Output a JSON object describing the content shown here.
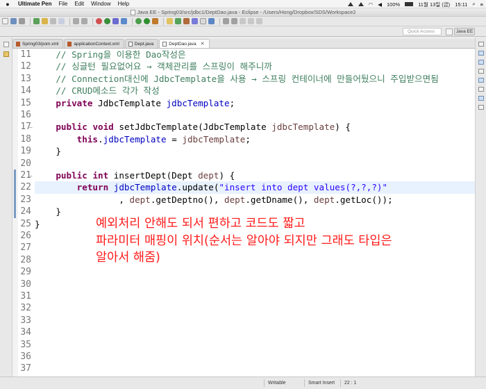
{
  "menubar": {
    "app_name": "Ultimate Pen",
    "menus": [
      "File",
      "Edit",
      "Window",
      "Help"
    ],
    "battery": "100%",
    "date": "11월 13일 (금)",
    "time": "15:11"
  },
  "window": {
    "title": "Java EE - Spring03/src/jdbc1/DeptDao.java - Eclipse - /Users/Hong/Dropbox/SDS/Workspace2"
  },
  "toolbar": {
    "quick_access_placeholder": "Quick Access",
    "perspective_label": "Java EE"
  },
  "tabs": [
    {
      "label": "Spring03/pom.xml",
      "icon": "xml-file-icon",
      "active": false
    },
    {
      "label": "applicationContext.xml",
      "icon": "xml-file-icon",
      "active": false
    },
    {
      "label": "Dept.java",
      "icon": "java-file-icon",
      "active": false
    },
    {
      "label": "DeptDao.java",
      "icon": "java-file-icon",
      "active": true,
      "close": "✕"
    }
  ],
  "editor": {
    "line_numbers": [
      "11",
      "12",
      "13",
      "14",
      "15",
      "16",
      "17",
      "18",
      "19",
      "20",
      "21",
      "22",
      "23",
      "24",
      "25",
      "26",
      "27",
      "28",
      "29",
      "30",
      "31",
      "32",
      "33",
      "34",
      "35",
      "36",
      "37"
    ],
    "lines": [
      [
        {
          "t": "    ",
          "c": ""
        },
        {
          "t": "// Spring을 이용한 Dao작성은",
          "c": "cm"
        }
      ],
      [
        {
          "t": "    ",
          "c": ""
        },
        {
          "t": "// 싱글턴 필요없어요 → 객체관리를 스프링이 해주니까",
          "c": "cm"
        }
      ],
      [
        {
          "t": "    ",
          "c": ""
        },
        {
          "t": "// Connection대신에 JdbcTemplate을 사용 → 스프링 컨테이너에 만들어뒀으니 주입받으면됨",
          "c": "cm"
        }
      ],
      [
        {
          "t": "    ",
          "c": ""
        },
        {
          "t": "// CRUD메소드 각가 작성",
          "c": "cm"
        }
      ],
      [
        {
          "t": "    ",
          "c": ""
        },
        {
          "t": "private",
          "c": "kw"
        },
        {
          "t": " JdbcTemplate ",
          "c": ""
        },
        {
          "t": "jdbcTemplate",
          "c": "fd"
        },
        {
          "t": ";",
          "c": ""
        }
      ],
      [],
      [
        {
          "t": "    ",
          "c": ""
        },
        {
          "t": "public",
          "c": "kw"
        },
        {
          "t": " ",
          "c": ""
        },
        {
          "t": "void",
          "c": "kw"
        },
        {
          "t": " setJdbcTemplate(JdbcTemplate ",
          "c": ""
        },
        {
          "t": "jdbcTemplate",
          "c": "pr"
        },
        {
          "t": ") {",
          "c": ""
        }
      ],
      [
        {
          "t": "        ",
          "c": ""
        },
        {
          "t": "this",
          "c": "kw"
        },
        {
          "t": ".",
          "c": ""
        },
        {
          "t": "jdbcTemplate",
          "c": "fd"
        },
        {
          "t": " = ",
          "c": ""
        },
        {
          "t": "jdbcTemplate",
          "c": "pr"
        },
        {
          "t": ";",
          "c": ""
        }
      ],
      [
        {
          "t": "    }",
          "c": ""
        }
      ],
      [],
      [
        {
          "t": "    ",
          "c": ""
        },
        {
          "t": "public",
          "c": "kw"
        },
        {
          "t": " ",
          "c": ""
        },
        {
          "t": "int",
          "c": "kw"
        },
        {
          "t": " insertDept(Dept ",
          "c": ""
        },
        {
          "t": "dept",
          "c": "pr"
        },
        {
          "t": ") {",
          "c": ""
        }
      ],
      [
        {
          "t": "        ",
          "c": ""
        },
        {
          "t": "return",
          "c": "kw"
        },
        {
          "t": " ",
          "c": ""
        },
        {
          "t": "jdbcTemplate",
          "c": "fd"
        },
        {
          "t": ".update(",
          "c": ""
        },
        {
          "t": "\"insert into dept values(?,?,?)\"",
          "c": "st"
        }
      ],
      [
        {
          "t": "                ",
          "c": ""
        },
        {
          "t": ", ",
          "c": ""
        },
        {
          "t": "dept",
          "c": "pr"
        },
        {
          "t": ".getDeptno(), ",
          "c": ""
        },
        {
          "t": "dept",
          "c": "pr"
        },
        {
          "t": ".getDname(), ",
          "c": ""
        },
        {
          "t": "dept",
          "c": "pr"
        },
        {
          "t": ".getLoc());",
          "c": ""
        }
      ],
      [
        {
          "t": "    }",
          "c": ""
        }
      ],
      [
        {
          "t": "}",
          "c": ""
        }
      ],
      [],
      [],
      [],
      [],
      [],
      [],
      [],
      [],
      [],
      [],
      [],
      []
    ],
    "current_line": 22
  },
  "annotation": {
    "lines": [
      "예외처리 안해도 되서 편하고 코드도 짧고",
      "파라미터 매핑이 위치(순서는 알아야 되지만 그래도 타입은",
      "알아서 해줌)"
    ]
  },
  "statusbar": {
    "mode": "Writable",
    "insert_mode": "Smart Insert",
    "position": "22 : 1"
  }
}
